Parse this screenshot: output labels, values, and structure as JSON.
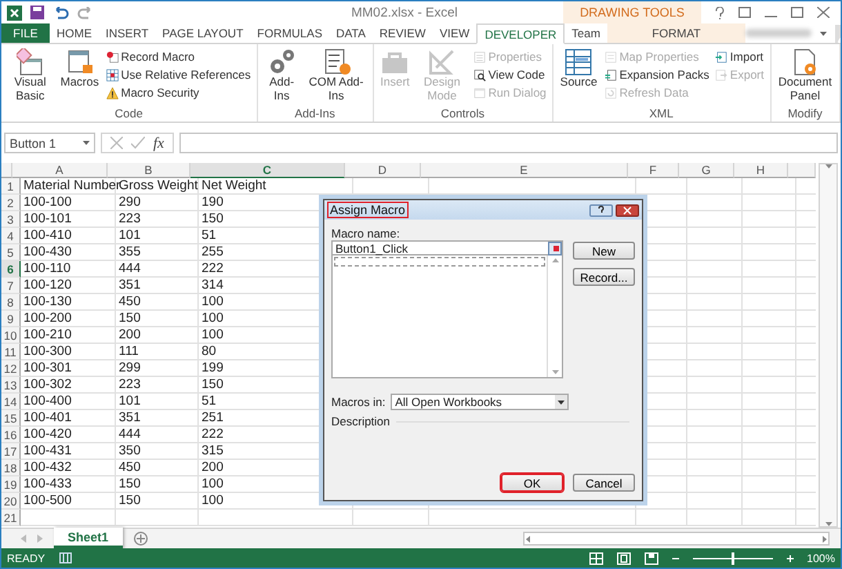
{
  "title_bar": {
    "title": "MM02.xlsx - Excel",
    "contextual_label": "DRAWING TOOLS"
  },
  "tabs": [
    {
      "label": "FILE",
      "kind": "file",
      "selected": false
    },
    {
      "label": "HOME",
      "kind": "standard",
      "selected": false
    },
    {
      "label": "INSERT",
      "kind": "standard",
      "selected": false
    },
    {
      "label": "PAGE LAYOUT",
      "kind": "standard",
      "selected": false
    },
    {
      "label": "FORMULAS",
      "kind": "standard",
      "selected": false
    },
    {
      "label": "DATA",
      "kind": "standard",
      "selected": false
    },
    {
      "label": "REVIEW",
      "kind": "standard",
      "selected": false
    },
    {
      "label": "VIEW",
      "kind": "standard",
      "selected": false
    },
    {
      "label": "DEVELOPER",
      "kind": "standard",
      "selected": true
    },
    {
      "label": "Team",
      "kind": "standard",
      "selected": false
    },
    {
      "label": "FORMAT",
      "kind": "contextual",
      "selected": false
    }
  ],
  "ribbon": {
    "groups": [
      {
        "label": "Code",
        "items": [
          {
            "kind": "large",
            "label": "Visual Basic",
            "disabled": false
          },
          {
            "kind": "large",
            "label": "Macros",
            "disabled": false
          },
          {
            "kind": "stack",
            "items": [
              {
                "label": "Record Macro",
                "disabled": false
              },
              {
                "label": "Use Relative References",
                "disabled": false
              },
              {
                "label": "Macro Security",
                "disabled": false
              }
            ]
          }
        ]
      },
      {
        "label": "Add-Ins",
        "items": [
          {
            "kind": "large",
            "label": "Add-Ins",
            "disabled": false
          },
          {
            "kind": "large",
            "label": "COM Add-Ins",
            "disabled": false
          }
        ]
      },
      {
        "label": "Controls",
        "items": [
          {
            "kind": "large",
            "label": "Insert",
            "disabled": true
          },
          {
            "kind": "large",
            "label": "Design Mode",
            "disabled": true
          },
          {
            "kind": "stack",
            "items": [
              {
                "label": "Properties",
                "disabled": true
              },
              {
                "label": "View Code",
                "disabled": false
              },
              {
                "label": "Run Dialog",
                "disabled": true
              }
            ]
          }
        ]
      },
      {
        "label": "XML",
        "items": [
          {
            "kind": "large",
            "label": "Source",
            "disabled": false
          },
          {
            "kind": "stack",
            "items": [
              {
                "label": "Map Properties",
                "disabled": true
              },
              {
                "label": "Expansion Packs",
                "disabled": false
              },
              {
                "label": "Refresh Data",
                "disabled": true
              }
            ]
          },
          {
            "kind": "stack",
            "items": [
              {
                "label": "Import",
                "disabled": false
              },
              {
                "label": "Export",
                "disabled": true
              }
            ]
          }
        ]
      },
      {
        "label": "Modify",
        "items": [
          {
            "kind": "large",
            "label": "Document Panel",
            "disabled": false
          }
        ]
      }
    ]
  },
  "formula_bar": {
    "name_box": "Button 1",
    "function_label": "fx"
  },
  "sheet": {
    "columns": [
      {
        "label": "A",
        "selected": false
      },
      {
        "label": "B",
        "selected": false
      },
      {
        "label": "C",
        "selected": true
      },
      {
        "label": "D",
        "selected": false
      },
      {
        "label": "E",
        "selected": false
      },
      {
        "label": "F",
        "selected": false
      },
      {
        "label": "G",
        "selected": false
      },
      {
        "label": "H",
        "selected": false
      }
    ],
    "rows": [
      {
        "number": "1",
        "selected": false,
        "cells": [
          "Material Number",
          "Gross Weight",
          "Net Weight"
        ]
      },
      {
        "number": "2",
        "selected": false,
        "cells": [
          "100-100",
          "290",
          "190"
        ]
      },
      {
        "number": "3",
        "selected": false,
        "cells": [
          "100-101",
          "223",
          "150"
        ]
      },
      {
        "number": "4",
        "selected": false,
        "cells": [
          "100-410",
          "101",
          "51"
        ]
      },
      {
        "number": "5",
        "selected": false,
        "cells": [
          "100-430",
          "355",
          "255"
        ]
      },
      {
        "number": "6",
        "selected": true,
        "cells": [
          "100-110",
          "444",
          "222"
        ]
      },
      {
        "number": "7",
        "selected": false,
        "cells": [
          "100-120",
          "351",
          "314"
        ]
      },
      {
        "number": "8",
        "selected": false,
        "cells": [
          "100-130",
          "450",
          "100"
        ]
      },
      {
        "number": "9",
        "selected": false,
        "cells": [
          "100-200",
          "150",
          "100"
        ]
      },
      {
        "number": "10",
        "selected": false,
        "cells": [
          "100-210",
          "200",
          "100"
        ]
      },
      {
        "number": "11",
        "selected": false,
        "cells": [
          "100-300",
          "111",
          "80"
        ]
      },
      {
        "number": "12",
        "selected": false,
        "cells": [
          "100-301",
          "299",
          "199"
        ]
      },
      {
        "number": "13",
        "selected": false,
        "cells": [
          "100-302",
          "223",
          "150"
        ]
      },
      {
        "number": "14",
        "selected": false,
        "cells": [
          "100-400",
          "101",
          "51"
        ]
      },
      {
        "number": "15",
        "selected": false,
        "cells": [
          "100-401",
          "351",
          "251"
        ]
      },
      {
        "number": "16",
        "selected": false,
        "cells": [
          "100-420",
          "444",
          "222"
        ]
      },
      {
        "number": "17",
        "selected": false,
        "cells": [
          "100-431",
          "350",
          "315"
        ]
      },
      {
        "number": "18",
        "selected": false,
        "cells": [
          "100-432",
          "450",
          "200"
        ]
      },
      {
        "number": "19",
        "selected": false,
        "cells": [
          "100-433",
          "150",
          "100"
        ]
      },
      {
        "number": "20",
        "selected": false,
        "cells": [
          "100-500",
          "150",
          "100"
        ]
      },
      {
        "number": "21",
        "selected": false,
        "cells": []
      }
    ]
  },
  "sheet_tabs": [
    {
      "label": "Sheet1",
      "selected": true
    }
  ],
  "status_bar": {
    "status": "READY",
    "zoom": "100%",
    "zoom_level": {
      "level": 0.5
    }
  },
  "dialog": {
    "title": "Assign Macro",
    "title_highlighted": true,
    "macro_name_label": "Macro name:",
    "macro_name": "Button1_Click",
    "macros_in_label": "Macros in:",
    "macros_in": "All Open Workbooks",
    "description_label": "Description",
    "side_buttons": [
      {
        "label": "New"
      },
      {
        "label": "Record..."
      }
    ],
    "footer_buttons": [
      {
        "label": "OK",
        "highlighted": true
      },
      {
        "label": "Cancel",
        "highlighted": false
      }
    ]
  }
}
